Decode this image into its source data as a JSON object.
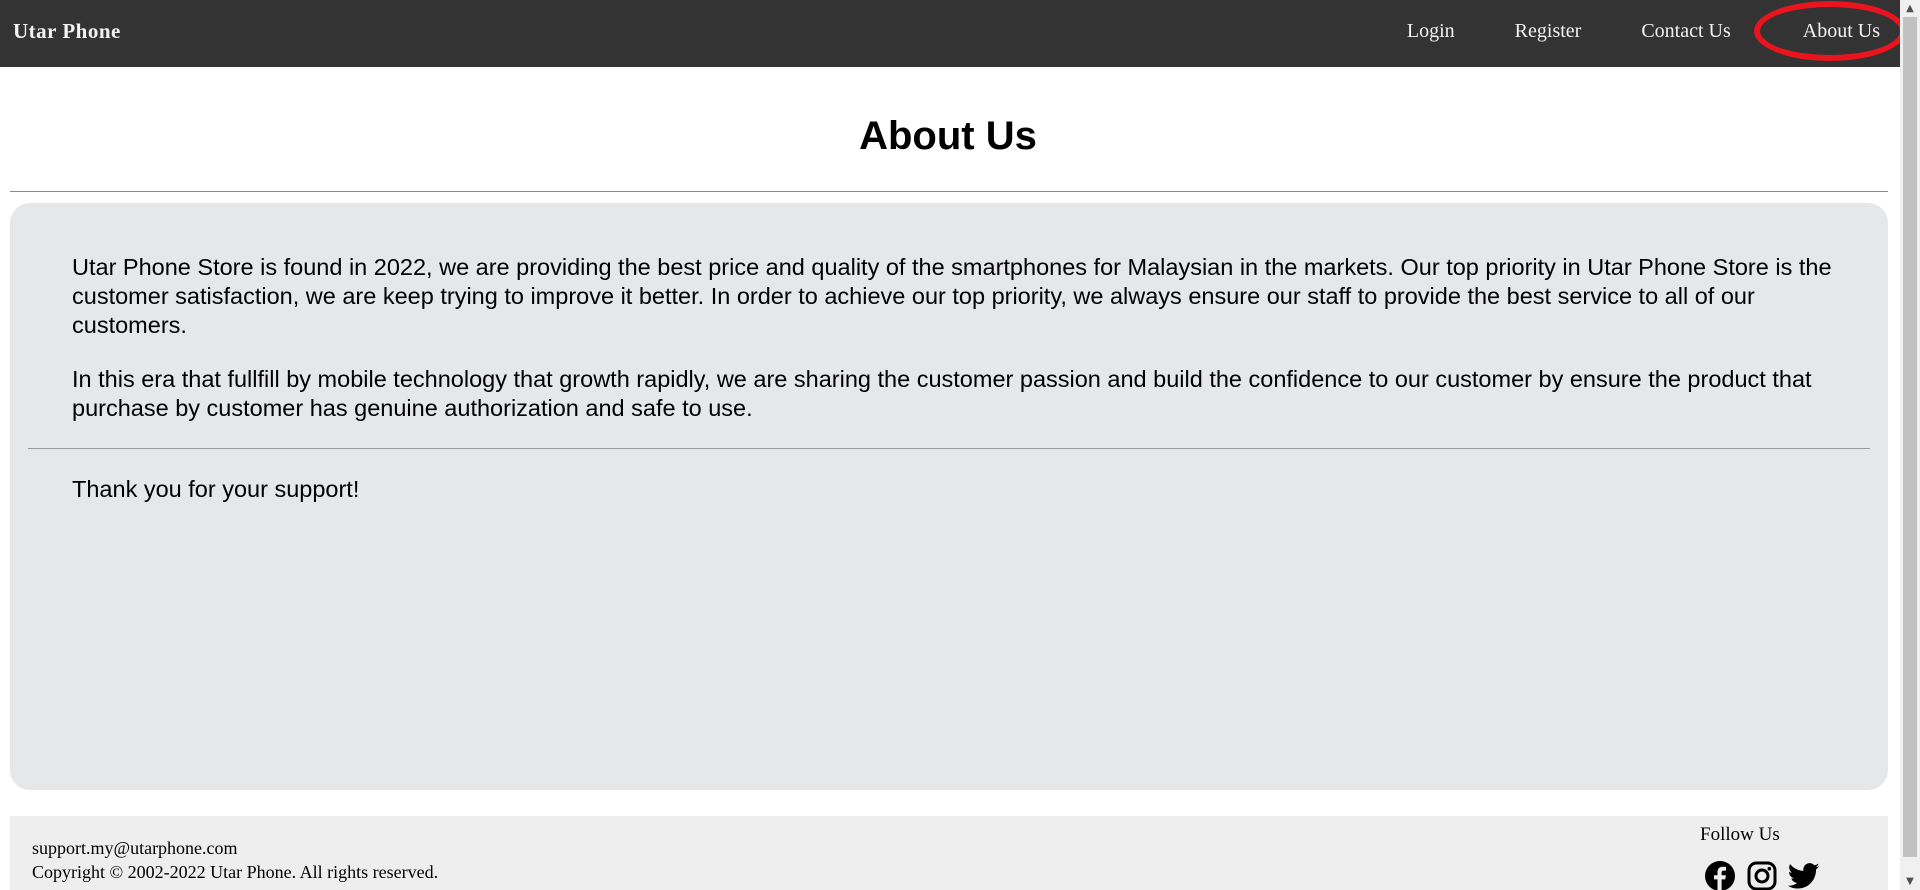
{
  "navbar": {
    "brand": "Utar Phone",
    "links": [
      {
        "label": "Login"
      },
      {
        "label": "Register"
      },
      {
        "label": "Contact Us"
      },
      {
        "label": "About Us"
      }
    ],
    "active_link": "About Us",
    "background_color": "#333333",
    "highlight_color": "#e8141e"
  },
  "main": {
    "title": "About Us",
    "paragraphs": [
      "Utar Phone Store is found in 2022, we are providing the best price and quality of the smartphones for Malaysian in the markets. Our top priority in Utar Phone Store is the customer satisfaction, we are keep trying to improve it better. In order to achieve our top priority, we always ensure our staff to provide the best service to all of our customers.",
      "In this era that fullfill by mobile technology that growth rapidly, we are sharing the customer passion and build the confidence to our customer by ensure the product that purchase by customer has genuine authorization and safe to use."
    ],
    "closing": "Thank you for your support!",
    "card_color": "#e6e7e9"
  },
  "footer": {
    "email": "support.my@utarphone.com",
    "copyright": "Copyright © 2002-2022 Utar Phone. All rights reserved.",
    "follow_label": "Follow Us",
    "social_icons": [
      "facebook-icon",
      "instagram-icon",
      "twitter-icon"
    ]
  }
}
